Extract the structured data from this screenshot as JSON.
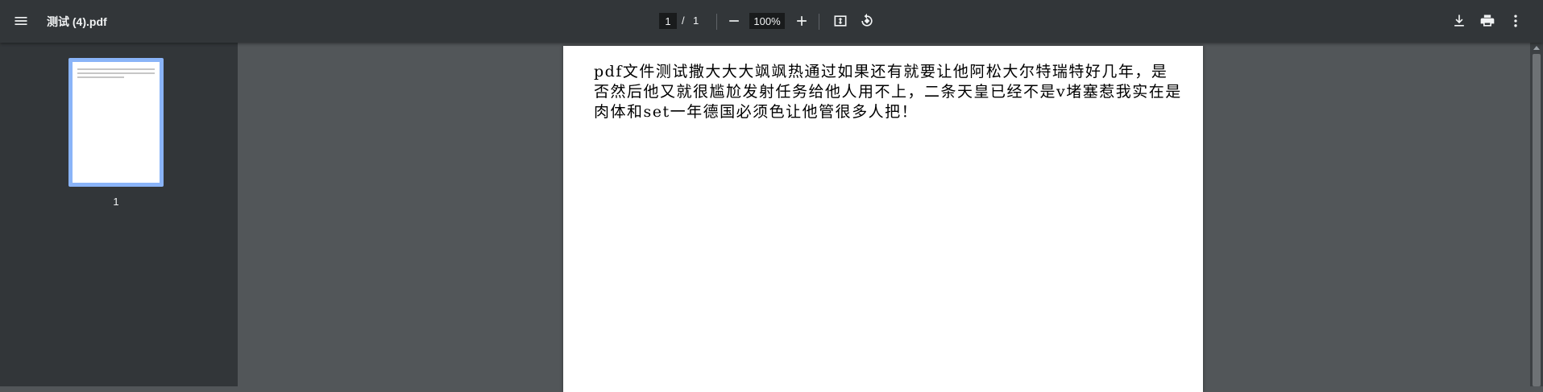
{
  "toolbar": {
    "title": "测试 (4).pdf",
    "page_current": "1",
    "page_separator": "/",
    "page_total": "1",
    "zoom": "100%"
  },
  "icons": {
    "menu": "menu-icon",
    "zoom_out": "minus-icon",
    "zoom_in": "plus-icon",
    "fit": "fit-page-icon",
    "rotate": "rotate-icon",
    "download": "download-icon",
    "print": "print-icon",
    "more": "more-vert-icon"
  },
  "sidebar": {
    "thumbnails": [
      {
        "label": "1"
      }
    ]
  },
  "document": {
    "text": "pdf文件测试撒大大大飒飒热通过如果还有就要让他阿松大尔特瑞特好几年，是否然后他又就很尴尬发射任务给他人用不上，二条天皇已经不是v堵塞惹我实在是肉体和set一年德国必须色让他管很多人把！"
  },
  "colors": {
    "toolbar_bg": "#323639",
    "viewer_bg": "#525659",
    "thumb_highlight": "#8ab4f8"
  }
}
